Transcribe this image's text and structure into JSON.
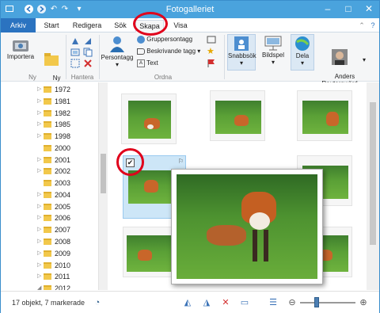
{
  "window": {
    "title": "Fotogalleriet"
  },
  "tabs": [
    {
      "label": "Arkiv"
    },
    {
      "label": "Start"
    },
    {
      "label": "Redigera"
    },
    {
      "label": "Sök"
    },
    {
      "label": "Skapa"
    },
    {
      "label": "Visa"
    }
  ],
  "ribbon": {
    "import_label": "Importera",
    "new_folder_label": "Ny\nmapp",
    "group_new": "Ny",
    "group_manage": "Hantera",
    "people_tag_label": "Persontagg",
    "group_tag_label": "Gruppersontagg",
    "desc_tag_label": "Beskrivande tagg",
    "text_label": "Text",
    "group_organize": "Ordna",
    "quickfind_label": "Snabbsök",
    "slideshow_label": "Bildspel",
    "share_label": "Dela",
    "user_label": "Anders\nReuterswärd"
  },
  "tree": {
    "years": [
      "1972",
      "1981",
      "1982",
      "1985",
      "1998",
      "2000",
      "2001",
      "2002",
      "2003",
      "2004",
      "2005",
      "2006",
      "2007",
      "2008",
      "2009",
      "2010",
      "2011",
      "2012"
    ]
  },
  "status": {
    "text": "17 objekt, 7 markerade"
  },
  "colors": {
    "accent": "#2b73c0",
    "highlight": "#e0001b"
  }
}
